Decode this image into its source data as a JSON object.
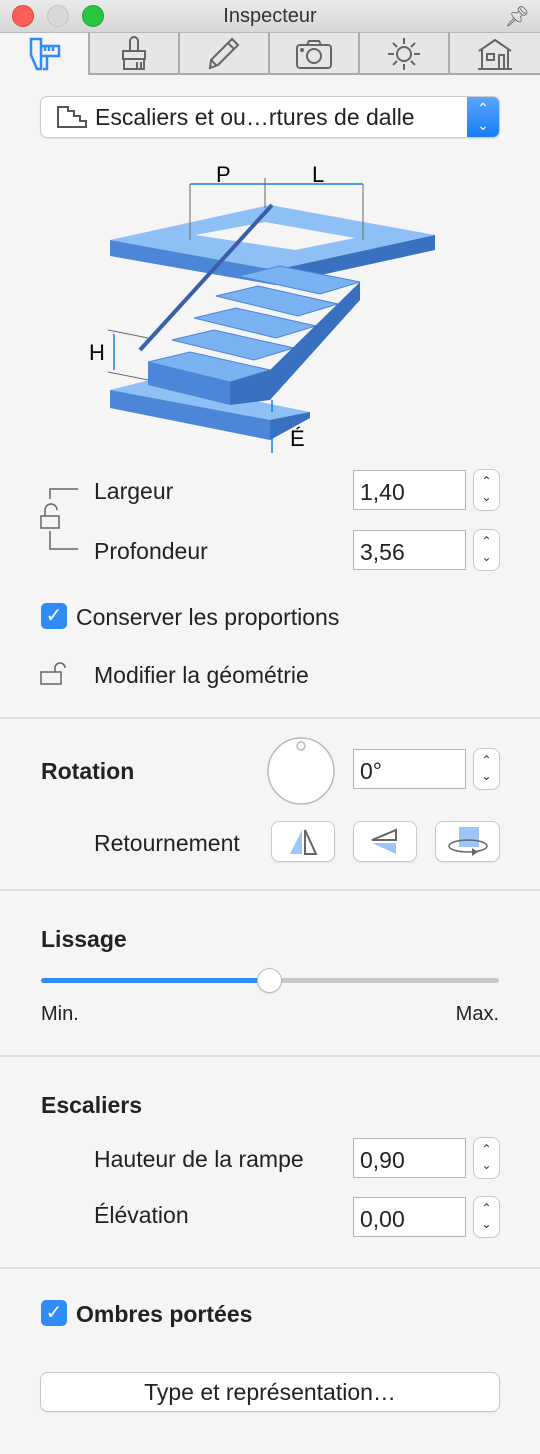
{
  "window": {
    "title": "Inspecteur"
  },
  "tabs": [
    {
      "icon": "caliper-icon",
      "selected": true
    },
    {
      "icon": "brush-icon"
    },
    {
      "icon": "pencil-icon"
    },
    {
      "icon": "camera-icon"
    },
    {
      "icon": "sun-icon"
    },
    {
      "icon": "house-icon"
    }
  ],
  "object_type": {
    "selected": "Escaliers et ou…rtures de dalle",
    "icon": "stairs-icon"
  },
  "diagram": {
    "p": "P",
    "l": "L",
    "h": "H",
    "e": "É"
  },
  "dimensions": {
    "width_label": "Largeur",
    "width_value": "1,40",
    "depth_label": "Profondeur",
    "depth_value": "3,56",
    "keep_proportions_label": "Conserver les proportions",
    "keep_proportions": true,
    "modify_geometry_label": "Modifier la géométrie"
  },
  "rotation": {
    "heading": "Rotation",
    "value": "0°",
    "flip_label": "Retournement"
  },
  "smoothing": {
    "heading": "Lissage",
    "min_label": "Min.",
    "max_label": "Max.",
    "level": 0.5
  },
  "stairs": {
    "heading": "Escaliers",
    "rail_height_label": "Hauteur de la rampe",
    "rail_height_value": "0,90",
    "elevation_label": "Élévation",
    "elevation_value": "0,00"
  },
  "shadows": {
    "label": "Ombres portées",
    "checked": true
  },
  "type_button": "Type et représentation…",
  "colors": {
    "accent": "#2f8cf6",
    "stairs": "#6aaaf0"
  }
}
